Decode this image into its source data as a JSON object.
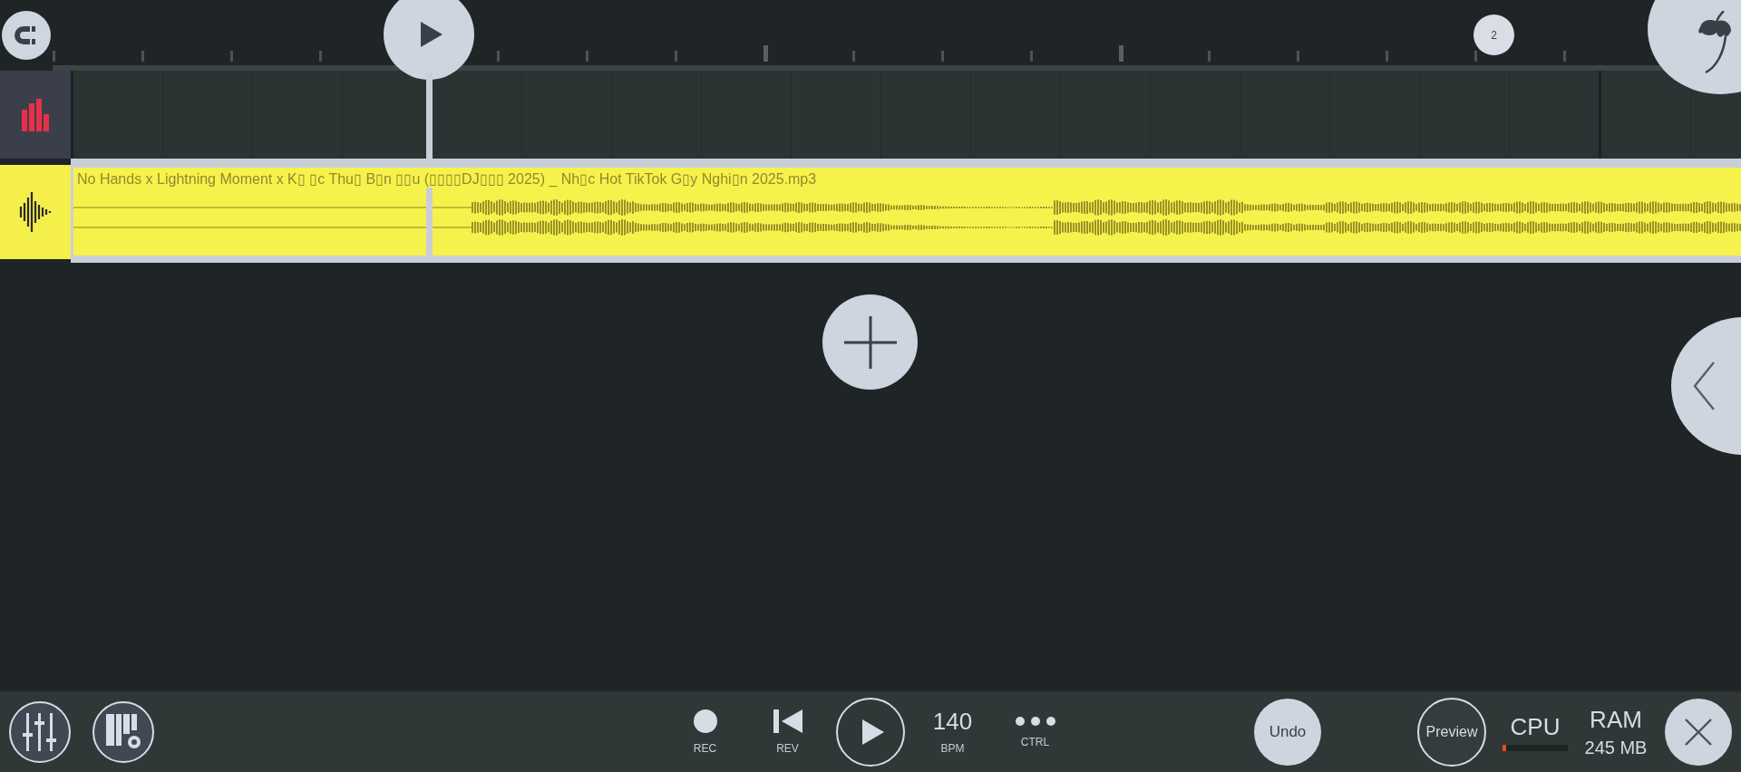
{
  "ruler": {
    "marker": "2"
  },
  "tracks": [
    {
      "kind": "pattern"
    },
    {
      "kind": "audio",
      "clip": {
        "title": "No Hands x Lightning Moment x K▯ ▯c Thu▯ B▯n ▯▯u (▯▯▯▯DJ▯▯▯ 2025) _ Nh▯c Hot TikTok G▯y Nghi▯n 2025.mp3"
      }
    }
  ],
  "transport": {
    "rec": "REC",
    "rev": "REV",
    "tempo": "140",
    "tempo_label": "BPM",
    "ctrl": "CTRL"
  },
  "buttons": {
    "undo": "Undo",
    "preview": "Preview"
  },
  "cpu": {
    "label": "CPU",
    "level": 0.05
  },
  "ram": {
    "label": "RAM",
    "value": "245 MB"
  }
}
